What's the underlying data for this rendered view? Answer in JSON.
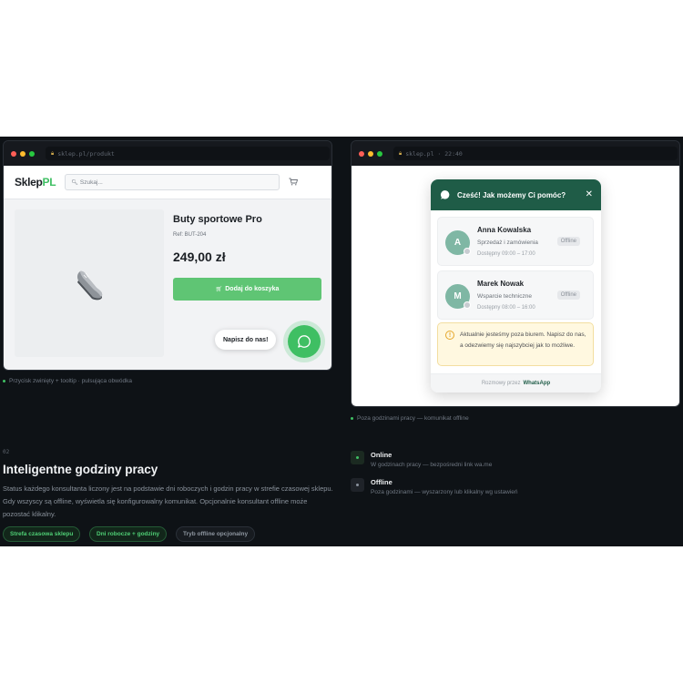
{
  "left_window": {
    "url": "sklep.pl/produkt",
    "logo_main": "Sklep",
    "logo_accent": "PL",
    "search_placeholder": "Szukaj...",
    "product_title": "Buty sportowe Pro",
    "product_ref": "Ref: BUT-204",
    "product_price": "249,00 zł",
    "add_to_cart": "Dodaj do koszyka",
    "tooltip": "Napisz do nas!",
    "caption": "Przycisk zwinięty + tooltip · pulsująca obwódka"
  },
  "right_window": {
    "url": "sklep.pl · 22:40",
    "widget_title": "Cześć! Jak możemy Ci pomóc?",
    "agents": [
      {
        "initial": "A",
        "name": "Anna Kowalska",
        "role": "Sprzedaż i zamówienia",
        "hours": "Dostępny 09:00 – 17:00",
        "status": "Offline"
      },
      {
        "initial": "M",
        "name": "Marek Nowak",
        "role": "Wsparcie techniczne",
        "hours": "Dostępny 08:00 – 16:00",
        "status": "Offline"
      }
    ],
    "notice": "Aktualnie jesteśmy poza biurem. Napisz do nas, a odezwiemy się najszybciej jak to możliwe.",
    "footer_prefix": "Rozmowy przez",
    "footer_brand": "WhatsApp",
    "caption": "Poza godzinami pracy — komunikat offline"
  },
  "section": {
    "number": "02",
    "title": "Inteligentne godziny pracy",
    "text": "Status każdego konsultanta liczony jest na podstawie dni roboczych i godzin pracy w strefie czasowej sklepu. Gdy wszyscy są offline, wyświetla się konfigurowalny komunikat. Opcjonalnie konsultant offline może pozostać klikalny.",
    "pills": [
      "Strefa czasowa sklepu",
      "Dni robocze + godziny",
      "Tryb offline opcjonalny"
    ]
  },
  "statuses": [
    {
      "label": "Online",
      "desc": "W godzinach pracy — bezpośredni link wa.me",
      "color": "#3fbf63"
    },
    {
      "label": "Offline",
      "desc": "Poza godzinami — wyszarzony lub klikalny wg ustawień",
      "color": "#8a929c"
    }
  ],
  "colors": {
    "accent": "#3fbf63",
    "whatsapp_dark": "#1f5c47",
    "background": "#0e1216"
  }
}
